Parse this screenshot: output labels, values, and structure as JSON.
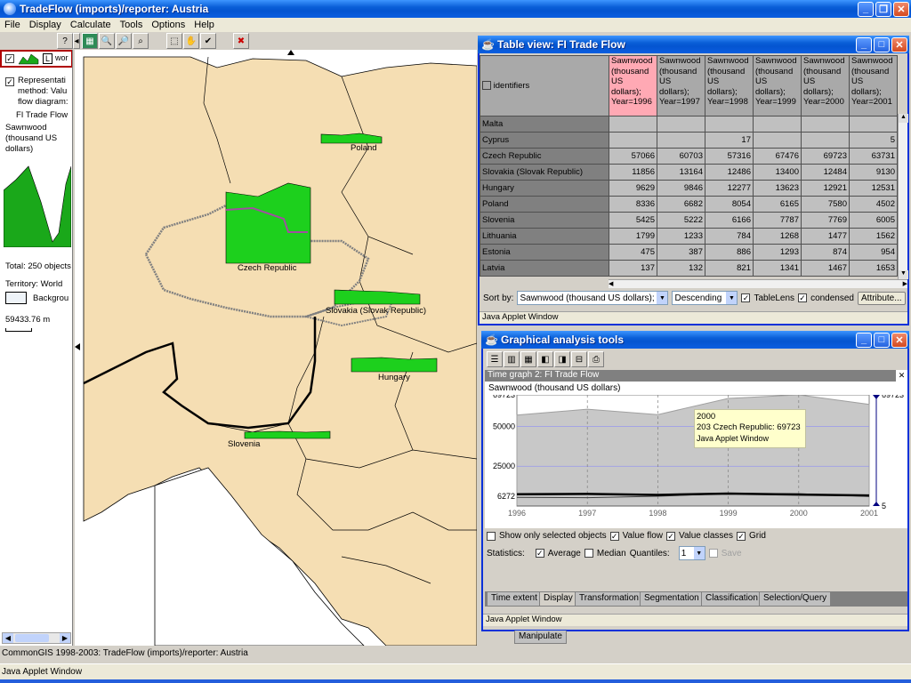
{
  "main_window": {
    "title": "TradeFlow (imports)/reporter: Austria",
    "menu": [
      "File",
      "Display",
      "Calculate",
      "Tools",
      "Options",
      "Help"
    ]
  },
  "toolbar": {
    "help_label": "?",
    "buttons": [
      "map-select-icon",
      "zoom-in-icon",
      "zoom-out-icon",
      "find-icon",
      "rectangle-select-icon",
      "pan-hand-icon",
      "check-icon",
      "no-selection-icon"
    ]
  },
  "left_panel": {
    "layer_label": "L",
    "layer_text": "wor",
    "representation": "Representation method: Value flow diagrams",
    "representation_lines": [
      "Representati",
      "method: Valu",
      "flow diagram:"
    ],
    "dataset": "FI Trade Flow",
    "attribute_lines": [
      "Sawnwood",
      "(thousand US",
      "dollars)"
    ],
    "total": "Total: 250 objects",
    "territory": "Territory: World",
    "background": "Backgrou",
    "scale": "59433.76 m"
  },
  "map": {
    "countries": [
      {
        "name": "Poland"
      },
      {
        "name": "Czech Republic"
      },
      {
        "name": "Slovakia (Slovak Republic)"
      },
      {
        "name": "Hungary"
      },
      {
        "name": "Slovenia"
      }
    ]
  },
  "table_window": {
    "title": "Table view: FI Trade Flow",
    "identifiers_label": "identifiers",
    "columns": [
      "Sawnwood (thousand US dollars); Year=1996",
      "Sawnwood (thousand US dollars); Year=1997",
      "Sawnwood (thousand US dollars); Year=1998",
      "Sawnwood (thousand US dollars); Year=1999",
      "Sawnwood (thousand US dollars); Year=2000",
      "Sawnwood (thousand US dollars); Year=2001"
    ],
    "column_lines": [
      [
        "Sawnwood",
        "(thousand",
        "US dollars);",
        "Year=1996"
      ],
      [
        "Sawnwood",
        "(thousand",
        "US dollars);",
        "Year=1997"
      ],
      [
        "Sawnwood",
        "(thousand",
        "US dollars);",
        "Year=1998"
      ],
      [
        "Sawnwood",
        "(thousand",
        "US dollars);",
        "Year=1999"
      ],
      [
        "Sawnwood",
        "(thousand",
        "US dollars);",
        "Year=2000"
      ],
      [
        "Sawnwood",
        "(thousand",
        "US dollars);",
        "Year=2001"
      ]
    ],
    "rows": [
      {
        "name": "Malta",
        "values": [
          "",
          "",
          "",
          "",
          "",
          ""
        ]
      },
      {
        "name": "Cyprus",
        "values": [
          "",
          "",
          "17",
          "",
          "",
          "5"
        ]
      },
      {
        "name": "Czech Republic",
        "values": [
          "57066",
          "60703",
          "57316",
          "67476",
          "69723",
          "63731"
        ]
      },
      {
        "name": "Slovakia (Slovak Republic)",
        "values": [
          "11856",
          "13164",
          "12486",
          "13400",
          "12484",
          "9130"
        ]
      },
      {
        "name": "Hungary",
        "values": [
          "9629",
          "9846",
          "12277",
          "13623",
          "12921",
          "12531"
        ]
      },
      {
        "name": "Poland",
        "values": [
          "8336",
          "6682",
          "8054",
          "6165",
          "7580",
          "4502"
        ]
      },
      {
        "name": "Slovenia",
        "values": [
          "5425",
          "5222",
          "6166",
          "7787",
          "7769",
          "6005"
        ]
      },
      {
        "name": "Lithuania",
        "values": [
          "1799",
          "1233",
          "784",
          "1268",
          "1477",
          "1562"
        ]
      },
      {
        "name": "Estonia",
        "values": [
          "475",
          "387",
          "886",
          "1293",
          "874",
          "954"
        ]
      },
      {
        "name": "Latvia",
        "values": [
          "137",
          "132",
          "821",
          "1341",
          "1467",
          "1653"
        ]
      }
    ],
    "sort_by_label": "Sort by:",
    "sort_by_value": "Sawnwood (thousand US dollars);",
    "order_value": "Descending",
    "tablelens_label": "TableLens",
    "condensed_label": "condensed",
    "attribute_button": "Attribute...",
    "status": "Java Applet Window"
  },
  "graph_window": {
    "title": "Graphical analysis tools",
    "panel_title": "Time graph 2: FI Trade Flow",
    "attribute": "Sawnwood (thousand US dollars)",
    "tooltip": {
      "line1": "2000",
      "line2": "203 Czech Republic: 69723",
      "line3": "Java Applet Window"
    },
    "options": {
      "only_selected": "Show only selected objects",
      "value_flow": "Value flow",
      "value_classes": "Value classes",
      "grid": "Grid"
    },
    "statistics": {
      "label": "Statistics:",
      "average": "Average",
      "median": "Median",
      "quantiles": "Quantiles:",
      "quantiles_value": "1",
      "save": "Save"
    },
    "tabs": [
      "Time extent",
      "Display",
      "Transformation",
      "Segmentation",
      "Classification",
      "Selection/Query"
    ],
    "status": "Java Applet Window",
    "manipulate_tab": "Manipulate"
  },
  "chart_data": {
    "type": "area",
    "title": "Sawnwood (thousand US dollars)",
    "x": [
      1996,
      1997,
      1998,
      1999,
      2000,
      2001
    ],
    "x_ticks": [
      "1996",
      "1997",
      "1998",
      "1999",
      "2000",
      "2001"
    ],
    "y_ticks_left": [
      "69723",
      "50000",
      "25000",
      "6272"
    ],
    "y_ticks_right": [
      "69723",
      "5"
    ],
    "ylim": [
      5,
      69723
    ],
    "grid": true,
    "envelope_max": [
      57066,
      60703,
      57316,
      67476,
      69723,
      63731
    ],
    "average_line": [
      7400,
      7600,
      7000,
      7800,
      7200,
      6600
    ],
    "selected_series_values": [
      5425,
      5222,
      6166,
      7787,
      7769,
      6005
    ],
    "min_line": [
      5,
      5,
      5,
      5,
      5,
      5
    ]
  },
  "status_bar": {
    "line1": "CommonGIS 1998-2003: TradeFlow (imports)/reporter: Austria",
    "line2": "Java Applet Window"
  }
}
